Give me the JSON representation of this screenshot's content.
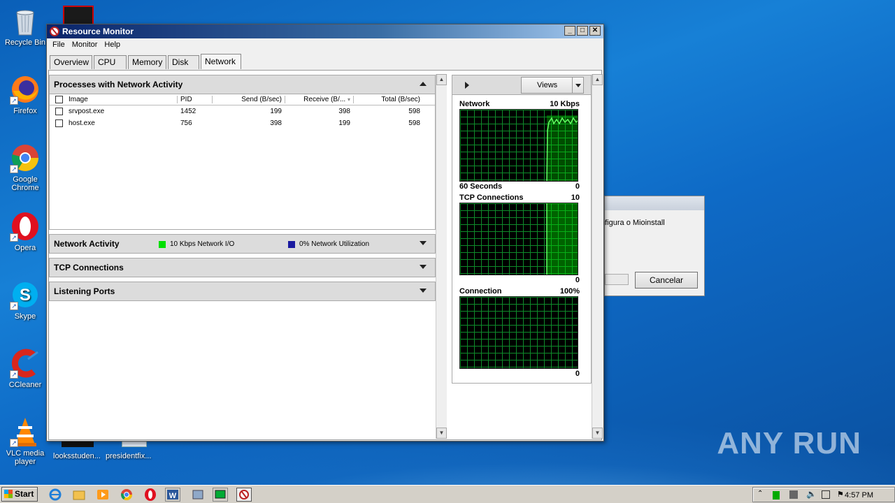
{
  "desktop": {
    "icons": [
      {
        "label": "Recycle Bin"
      },
      {
        "label": "Firefox"
      },
      {
        "label": "Google Chrome"
      },
      {
        "label": "Opera"
      },
      {
        "label": "Skype"
      },
      {
        "label": "CCleaner"
      },
      {
        "label": "VLC media player"
      }
    ],
    "files": [
      {
        "label": "looksstuden..."
      },
      {
        "label": "presidentfix..."
      }
    ],
    "watermark": "ANY RUN"
  },
  "bg_dialog": {
    "message": "nfigura o Mioinstall",
    "cancel_label": "Cancelar"
  },
  "window": {
    "title": "Resource Monitor",
    "menu": [
      "File",
      "Monitor",
      "Help"
    ],
    "tabs": [
      "Overview",
      "CPU",
      "Memory",
      "Disk",
      "Network"
    ],
    "active_tab": "Network"
  },
  "processes": {
    "title": "Processes with Network Activity",
    "columns": [
      "Image",
      "PID",
      "Send (B/sec)",
      "Receive (B/...",
      "Total (B/sec)"
    ],
    "rows": [
      {
        "image": "srvpost.exe",
        "pid": "1452",
        "send": "199",
        "receive": "398",
        "total": "598"
      },
      {
        "image": "host.exe",
        "pid": "756",
        "send": "398",
        "receive": "199",
        "total": "598"
      }
    ]
  },
  "network_activity": {
    "title": "Network Activity",
    "io_label": "10 Kbps Network I/O",
    "util_label": "0% Network Utilization",
    "io_color": "#00e000",
    "util_color": "#1a1aa0"
  },
  "tcp": {
    "title": "TCP Connections"
  },
  "listening": {
    "title": "Listening Ports"
  },
  "right_panel": {
    "views_label": "Views",
    "graphs": [
      {
        "title": "Network",
        "max": "10 Kbps",
        "bottom_left": "60 Seconds",
        "bottom_right": "0",
        "fill_from": 0.73,
        "level": 0.9
      },
      {
        "title": "TCP Connections",
        "max": "10",
        "bottom_left": "",
        "bottom_right": "0",
        "fill_from": 0.73,
        "level": 1.0
      },
      {
        "title": "Connection",
        "max": "100%",
        "bottom_left": "",
        "bottom_right": "0",
        "fill_from": 1.0,
        "level": 0
      }
    ]
  },
  "taskbar": {
    "start_label": "Start",
    "clock": "4:57 PM"
  }
}
